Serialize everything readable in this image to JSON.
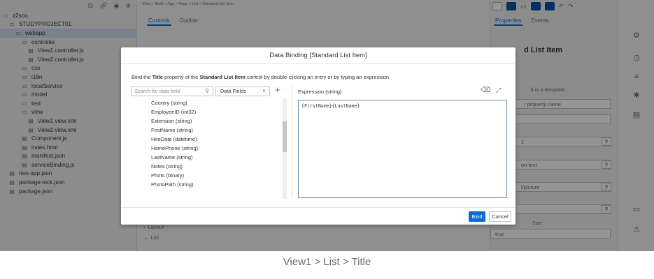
{
  "explorer": {
    "toolbar_icons": [
      "collapse-icon",
      "link-icon",
      "eye-icon",
      "filter-icon"
    ],
    "items": [
      {
        "label": "z2soo",
        "icon": "folder-icon",
        "level": 0
      },
      {
        "label": "STUDYPROJECT01",
        "icon": "folder-icon",
        "level": 1
      },
      {
        "label": "webapp",
        "icon": "folder-icon",
        "level": 2,
        "selected": true
      },
      {
        "label": "controller",
        "icon": "folder-icon",
        "level": 3
      },
      {
        "label": "View1.controller.js",
        "icon": "file-icon",
        "level": 4
      },
      {
        "label": "View2.controller.js",
        "icon": "file-icon",
        "level": 4
      },
      {
        "label": "css",
        "icon": "folder-icon",
        "level": 3
      },
      {
        "label": "i18n",
        "icon": "folder-icon",
        "level": 3
      },
      {
        "label": "localService",
        "icon": "folder-icon",
        "level": 3
      },
      {
        "label": "model",
        "icon": "folder-icon",
        "level": 3
      },
      {
        "label": "test",
        "icon": "folder-icon",
        "level": 3
      },
      {
        "label": "view",
        "icon": "folder-icon",
        "level": 3
      },
      {
        "label": "View1.view.xml",
        "icon": "file-icon",
        "level": 4
      },
      {
        "label": "View2.view.xml",
        "icon": "file-icon",
        "level": 4
      },
      {
        "label": "Component.js",
        "icon": "file-icon",
        "level": 3
      },
      {
        "label": "index.html",
        "icon": "file-icon",
        "level": 3
      },
      {
        "label": "manifest.json",
        "icon": "file-icon",
        "level": 3
      },
      {
        "label": "serviceBinding.js",
        "icon": "file-icon",
        "level": 3
      },
      {
        "label": "neo-app.json",
        "icon": "file-icon",
        "level": 1
      },
      {
        "label": "package-lock.json",
        "icon": "file-icon",
        "level": 1
      },
      {
        "label": "package.json",
        "icon": "file-icon",
        "level": 1
      }
    ]
  },
  "editor": {
    "breadcrumb": "View > Shell > App > Page > List > Standard List Item",
    "tabs": [
      "Controls",
      "Outline"
    ],
    "outline_rows": [
      "Layout",
      "List"
    ]
  },
  "properties": {
    "tabs": [
      "Properties",
      "Events"
    ],
    "title": "d List Item",
    "search_placeholder": "r property name",
    "template_note": "it is a template.",
    "fields": {
      "f1": "1",
      "f2": "on text",
      "f3": "l/picture",
      "size_label": "Size",
      "size_value": "true"
    }
  },
  "rail": {
    "icons": [
      "settings-icon",
      "clock-icon",
      "list-icon",
      "bug-icon",
      "clipboard-icon",
      "console-icon",
      "warning-icon"
    ]
  },
  "dialog": {
    "title": "Data Binding [Standard List Item]",
    "instruction": {
      "pre": "Bind the ",
      "prop": "Title",
      "mid": " property of the ",
      "control": "Standard List Item",
      "post": " control by double-clicking an entry or by typing an expression."
    },
    "search_placeholder": "Search for data field",
    "select_value": "Data Fields",
    "fields": [
      "Country (string)",
      "EmployeeID (int32)",
      "Extension (string)",
      "FirstName (string)",
      "HireDate (datetime)",
      "HomePhone (string)",
      "LastName (string)",
      "Notes (string)",
      "Photo (binary)",
      "PhotoPath (string)"
    ],
    "expression_label": "Expression (string)",
    "expression_value": "{FirstName}{LastName}",
    "bind_label": "Bind",
    "cancel_label": "Cancel"
  },
  "caption": "View1 > List > Title",
  "colors": {
    "accent": "#0a6ed1",
    "overlay": "#000000",
    "selection": "#cfe0f1"
  }
}
